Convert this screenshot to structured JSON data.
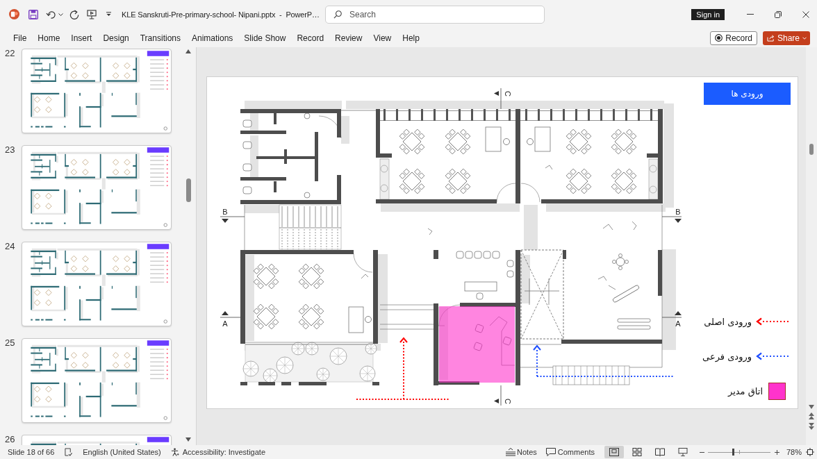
{
  "title_bar": {
    "document_title": "KLE Sanskruti-Pre-primary-school- Nipani.pptx  -  PowerP…",
    "search": {
      "placeholder": "Search"
    },
    "sign_in": "Sign in"
  },
  "menu": {
    "tabs": [
      {
        "label": "File",
        "selected": false
      },
      {
        "label": "Home",
        "selected": false
      },
      {
        "label": "Insert",
        "selected": false
      },
      {
        "label": "Design",
        "selected": false
      },
      {
        "label": "Transitions",
        "selected": false
      },
      {
        "label": "Animations",
        "selected": false
      },
      {
        "label": "Slide Show",
        "selected": false
      },
      {
        "label": "Record",
        "selected": false
      },
      {
        "label": "Review",
        "selected": false
      },
      {
        "label": "View",
        "selected": false
      },
      {
        "label": "Help",
        "selected": false
      }
    ],
    "record_button": "Record",
    "share_button": "Share"
  },
  "thumbnails": [
    {
      "number": "22",
      "selected": false
    },
    {
      "number": "23",
      "selected": false
    },
    {
      "number": "24",
      "selected": false
    },
    {
      "number": "25",
      "selected": false
    },
    {
      "number": "26",
      "selected": false
    }
  ],
  "slide": {
    "title": "ورودی ها",
    "section_markers": [
      {
        "label": "C"
      },
      {
        "label": "B"
      },
      {
        "label": "B"
      },
      {
        "label": "A"
      },
      {
        "label": "A"
      },
      {
        "label": "C"
      }
    ],
    "legend": [
      {
        "kind": "arrow",
        "label": "ورودی اصلی",
        "color": "#ff0000"
      },
      {
        "kind": "arrow",
        "label": "ورودی فرعی",
        "color": "#1f4fff"
      },
      {
        "kind": "swatch",
        "label": "اتاق مدیر",
        "color": "#ff33cc"
      }
    ]
  },
  "status_bar": {
    "slide_counter": "Slide 18 of 66",
    "language": "English (United States)",
    "accessibility": "Accessibility: Investigate",
    "notes": "Notes",
    "comments": "Comments",
    "views": [
      {
        "kind": "normal",
        "selected": true
      },
      {
        "kind": "sorter",
        "selected": false
      },
      {
        "kind": "reading",
        "selected": false
      },
      {
        "kind": "slideshow",
        "selected": false
      }
    ],
    "zoom": {
      "level": 0.4,
      "reading": "78%"
    }
  }
}
